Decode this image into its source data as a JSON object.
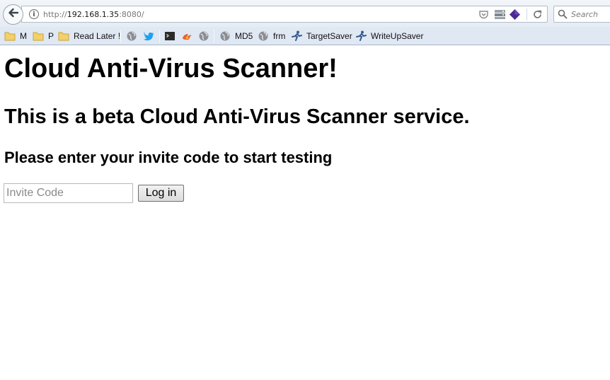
{
  "browser": {
    "url_scheme": "http://",
    "url_host": "192.168.1.35",
    "url_rest": ":8080/",
    "search_placeholder": "Search"
  },
  "bookmarks": [
    {
      "label": "M",
      "icon": "folder-icon"
    },
    {
      "label": "P",
      "icon": "folder-icon"
    },
    {
      "label": "Read Later !",
      "icon": "folder-icon"
    },
    {
      "label": "",
      "icon": "globe-icon"
    },
    {
      "label": "",
      "icon": "twitter-bird-icon"
    },
    {
      "label": "",
      "icon": "terminal-icon"
    },
    {
      "label": "",
      "icon": "fire-icon"
    },
    {
      "label": "",
      "icon": "globe-icon"
    },
    {
      "label": "MD5",
      "icon": "globe-icon"
    },
    {
      "label": "frm",
      "icon": "globe-icon"
    },
    {
      "label": "TargetSaver",
      "icon": "runner-icon"
    },
    {
      "label": "WriteUpSaver",
      "icon": "runner-icon"
    }
  ],
  "page": {
    "title": "Cloud Anti-Virus Scanner!",
    "subtitle": "This is a beta Cloud Anti-Virus Scanner service.",
    "prompt": "Please enter your invite code to start testing",
    "invite_placeholder": "Invite Code",
    "invite_value": "",
    "login_label": "Log in"
  }
}
